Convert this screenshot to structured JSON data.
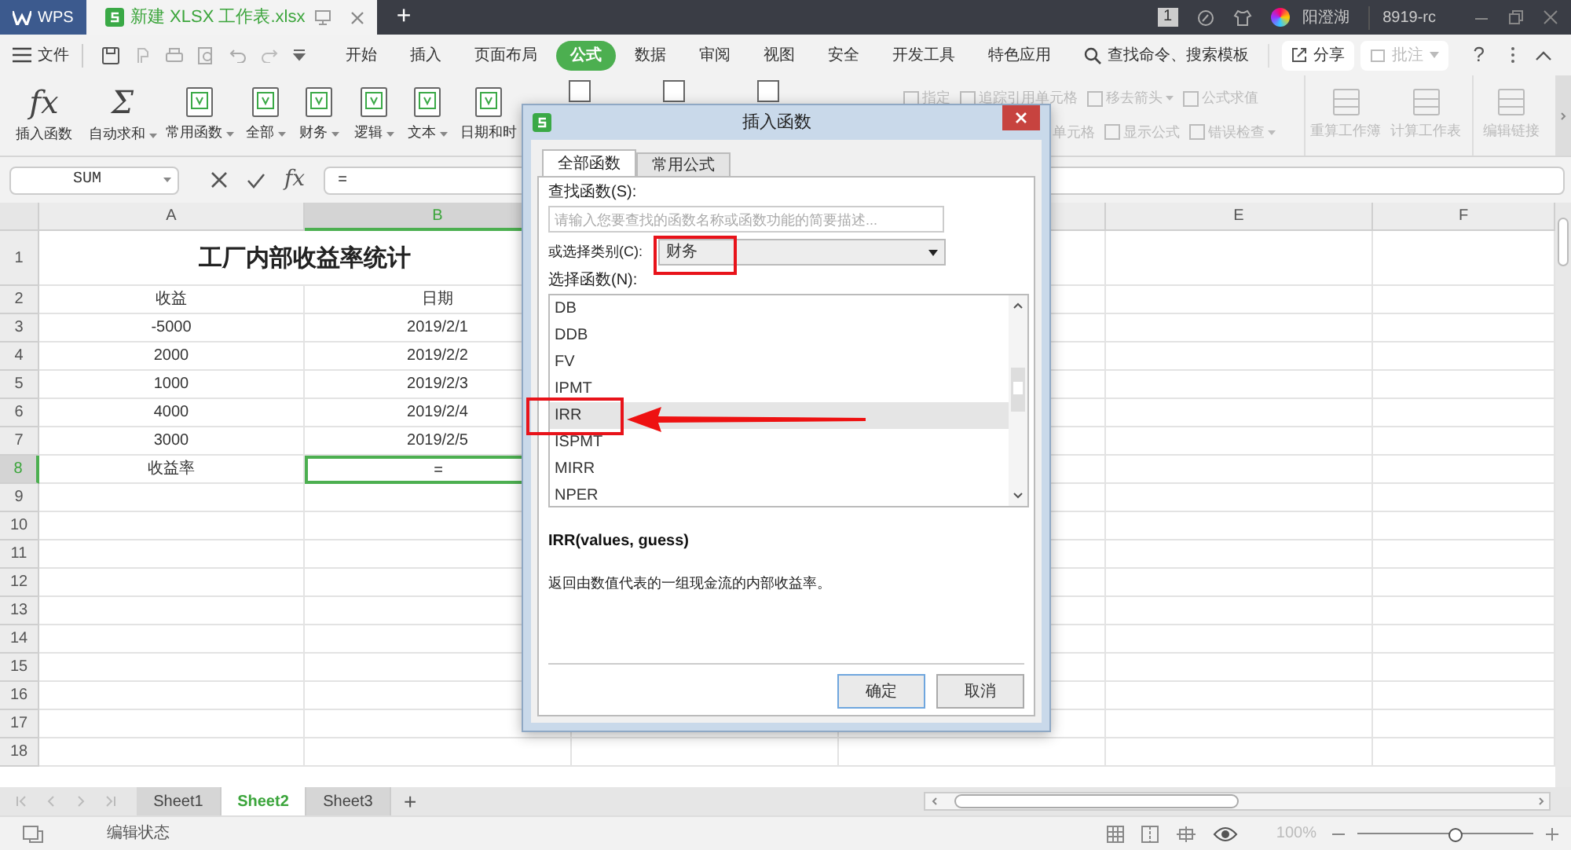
{
  "title_bar": {
    "app_tab": "WPS",
    "doc_tab": "新建 XLSX 工作表.xlsx",
    "new_tab": "+",
    "page_badge": "1",
    "user": "阳澄湖",
    "account": "8919-rc"
  },
  "menu": {
    "file": "文件",
    "tabs": [
      {
        "label": "开始",
        "selected": false
      },
      {
        "label": "插入",
        "selected": false
      },
      {
        "label": "页面布局",
        "selected": false
      },
      {
        "label": "公式",
        "selected": true
      },
      {
        "label": "数据",
        "selected": false
      },
      {
        "label": "审阅",
        "selected": false
      },
      {
        "label": "视图",
        "selected": false
      },
      {
        "label": "安全",
        "selected": false
      },
      {
        "label": "开发工具",
        "selected": false
      },
      {
        "label": "特色应用",
        "selected": false
      }
    ],
    "search": "查找命令、搜索模板",
    "share": "分享",
    "comment": "批注",
    "help": "?"
  },
  "ribbon": {
    "left": [
      {
        "label": "插入函数",
        "glyph": "fx",
        "dropdown": false
      },
      {
        "label": "自动求和",
        "glyph": "Σ",
        "dropdown": true
      },
      {
        "label": "常用函数",
        "dropdown": true
      },
      {
        "label": "全部",
        "dropdown": true
      },
      {
        "label": "财务",
        "dropdown": true
      },
      {
        "label": "逻辑",
        "dropdown": true
      },
      {
        "label": "文本",
        "dropdown": true
      },
      {
        "label": "日期和时",
        "dropdown": false
      }
    ],
    "audit_top": [
      {
        "label": "指定",
        "dropdown": false
      },
      {
        "label": "追踪引用单元格",
        "dropdown": false
      },
      {
        "label": "移去箭头",
        "dropdown": true
      },
      {
        "label": "公式求值",
        "dropdown": false
      }
    ],
    "audit_bottom": [
      {
        "label": "单元格",
        "dropdown": false
      },
      {
        "label": "显示公式",
        "dropdown": false
      },
      {
        "label": "错误检查",
        "dropdown": true
      }
    ],
    "calc": [
      {
        "label": "重算工作簿"
      },
      {
        "label": "计算工作表"
      },
      {
        "label": "编辑链接"
      }
    ]
  },
  "formula_bar": {
    "name_box": "SUM",
    "fx": "fx",
    "content": "="
  },
  "sheet": {
    "columns": [
      {
        "label": "A",
        "selected": false
      },
      {
        "label": "B",
        "selected": true
      },
      {
        "label": "E",
        "selected": false
      },
      {
        "label": "F",
        "selected": false
      }
    ],
    "rows": [
      {
        "number": "1",
        "kind": "title",
        "selected": false,
        "cells": [
          "工厂内部收益率统计"
        ]
      },
      {
        "number": "2",
        "selected": false,
        "cells": [
          "收益",
          "日期"
        ]
      },
      {
        "number": "3",
        "selected": false,
        "cells": [
          "-5000",
          "2019/2/1"
        ]
      },
      {
        "number": "4",
        "selected": false,
        "cells": [
          "2000",
          "2019/2/2"
        ]
      },
      {
        "number": "5",
        "selected": false,
        "cells": [
          "1000",
          "2019/2/3"
        ]
      },
      {
        "number": "6",
        "selected": false,
        "cells": [
          "4000",
          "2019/2/4"
        ]
      },
      {
        "number": "7",
        "selected": false,
        "cells": [
          "3000",
          "2019/2/5"
        ]
      },
      {
        "number": "8",
        "selected": true,
        "cells": [
          "收益率",
          "="
        ]
      },
      {
        "number": "9",
        "selected": false
      },
      {
        "number": "10",
        "selected": false
      },
      {
        "number": "11",
        "selected": false
      },
      {
        "number": "12",
        "selected": false
      },
      {
        "number": "13",
        "selected": false
      },
      {
        "number": "14",
        "selected": false
      },
      {
        "number": "15",
        "selected": false
      },
      {
        "number": "16",
        "selected": false
      },
      {
        "number": "17",
        "selected": false
      },
      {
        "number": "18",
        "selected": false
      }
    ],
    "tabs": [
      {
        "label": "Sheet1",
        "selected": false
      },
      {
        "label": "Sheet2",
        "selected": true
      },
      {
        "label": "Sheet3",
        "selected": false
      }
    ],
    "add_sheet": "+"
  },
  "status_bar": {
    "mode": "编辑状态",
    "zoom": "100%",
    "level": 0.55
  },
  "dialog": {
    "title": "插入函数",
    "tabs": [
      {
        "label": "全部函数",
        "selected": true
      },
      {
        "label": "常用公式",
        "selected": false
      }
    ],
    "search_label": "查找函数(S):",
    "search_placeholder": "请输入您要查找的函数名称或函数功能的简要描述...",
    "category_label": "或选择类别(C):",
    "category": "财务",
    "list_label": "选择函数(N):",
    "functions": [
      {
        "name": "DB",
        "selected": false
      },
      {
        "name": "DDB",
        "selected": false
      },
      {
        "name": "FV",
        "selected": false
      },
      {
        "name": "IPMT",
        "selected": false
      },
      {
        "name": "IRR",
        "selected": true
      },
      {
        "name": "ISPMT",
        "selected": false
      },
      {
        "name": "MIRR",
        "selected": false
      },
      {
        "name": "NPER",
        "selected": false
      }
    ],
    "signature": "IRR(values, guess)",
    "description": "返回由数值代表的一组现金流的内部收益率。",
    "buttons": [
      "确定",
      "取消"
    ]
  }
}
